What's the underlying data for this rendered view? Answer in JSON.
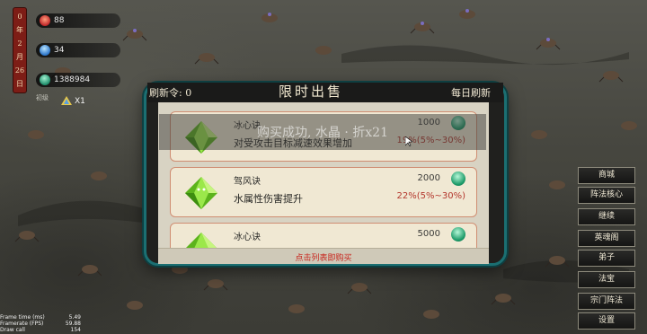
{
  "status": {
    "date": [
      "0",
      "年",
      "2",
      "月",
      "26",
      "日"
    ],
    "resources": [
      {
        "icon": "flame-icon",
        "value": "88"
      },
      {
        "icon": "water-drop-icon",
        "value": "34"
      },
      {
        "icon": "jade-icon",
        "value": "1388984"
      }
    ],
    "tier_label": "初级",
    "tier_count": "X1"
  },
  "dialog": {
    "refresh_tokens": "刷新令: 0",
    "title": "限时出售",
    "daily_refresh": "每日刷新",
    "items": [
      {
        "name": "冰心诀",
        "description": "对受攻击目标减速效果增加",
        "price": "1000",
        "percent": "19%(5%~30%)"
      },
      {
        "name": "驾风诀",
        "description": "水属性伤害提升",
        "price": "2000",
        "percent": "22%(5%~30%)"
      },
      {
        "name": "冰心诀",
        "description": "",
        "price": "5000",
        "percent": ""
      }
    ],
    "footer_hint": "点击列表即购买",
    "toast": "购买成功, 水晶 · 折x21"
  },
  "side_menu": [
    "商城",
    "阵法核心",
    "继续",
    "英魂阁",
    "弟子",
    "法宝",
    "宗门阵法",
    "设置"
  ],
  "debug": [
    {
      "label": "Frame time (ms)",
      "value": "5.49"
    },
    {
      "label": "Framerate (FPS)",
      "value": "59.88"
    },
    {
      "label": "Draw call",
      "value": "154"
    }
  ],
  "colors": {
    "frame": "#1b6f72",
    "accent_red": "#c8241c",
    "jade": "#1c9a68",
    "gem": "#7ed321"
  }
}
